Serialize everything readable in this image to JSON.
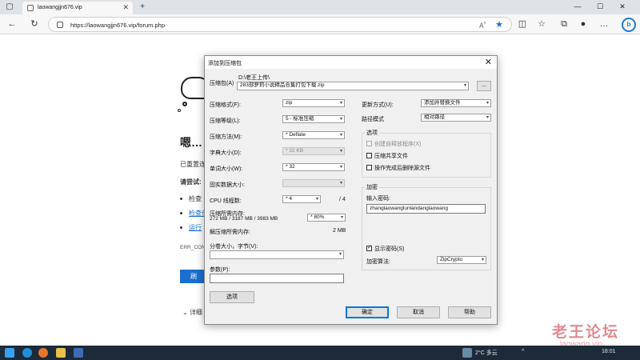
{
  "browser": {
    "tab_title": "laowangjjn676.vip",
    "new_tab": "+",
    "url": "https://laowangjjn676.vip/forum.php",
    "window_buttons": [
      "—",
      "☐",
      "✕"
    ]
  },
  "page": {
    "heading": "嗯…",
    "line1": "已重置连",
    "try_label": "请尝试:",
    "item1": "检查",
    "item2": "检查代",
    "item3": "运行",
    "error_code": "ERR_CON",
    "button": "刷",
    "details": "详细"
  },
  "dialog": {
    "title": "添加到压缩包",
    "close": "✕",
    "archive_label": "压缩包(A)",
    "archive_dir": "D:\\老王上传\\",
    "archive_name": "283部萝莉小说精品合集打包下载.zip",
    "browse_btn": "...",
    "format_label": "压缩格式(F):",
    "format_value": "zip",
    "level_label": "压缩等级(L):",
    "level_value": "5 - 标准压缩",
    "method_label": "压缩方法(M):",
    "method_value": "* Deflate",
    "dict_label": "字典大小(D):",
    "dict_value": "* 32 KB",
    "word_label": "单词大小(W):",
    "word_value": "* 32",
    "solid_label": "固实数据大小:",
    "solid_value": "",
    "cpu_label": "CPU 线程数:",
    "cpu_value": "* 4",
    "cpu_total": "/ 4",
    "mem_label": "压缩所需内存:",
    "mem_value": "272 MB / 3187 MB / 3983 MB",
    "mem_pct": "* 80%",
    "decomp_label": "解压缩所需内存:",
    "decomp_value": "2 MB",
    "split_label": "分卷大小，字节(V):",
    "split_value": "",
    "params_label": "参数(P):",
    "params_value": "",
    "options_btn": "选项",
    "update_label": "更新方式(U):",
    "update_value": "添加并替换文件",
    "path_label": "路径模式",
    "path_value": "相对路径",
    "options_group": "选项",
    "opt_sfx": "创建自释放程序(X)",
    "opt_shared": "压缩共享文件",
    "opt_delete": "操作完成后删除源文件",
    "encrypt_group": "加密",
    "pwd_label": "输入密码:",
    "pwd_value": "zhanglaowanglunlandanglaowang",
    "show_pwd": "显示密码(S)",
    "enc_method_label": "加密算法:",
    "enc_method_value": "ZipCrypto",
    "ok_btn": "确定",
    "cancel_btn": "取消",
    "help_btn": "帮助"
  },
  "taskbar": {
    "weather": "2°C 多云",
    "time": "18:01"
  },
  "watermark": {
    "text": "老王论坛",
    "url": "laowang.vip"
  }
}
